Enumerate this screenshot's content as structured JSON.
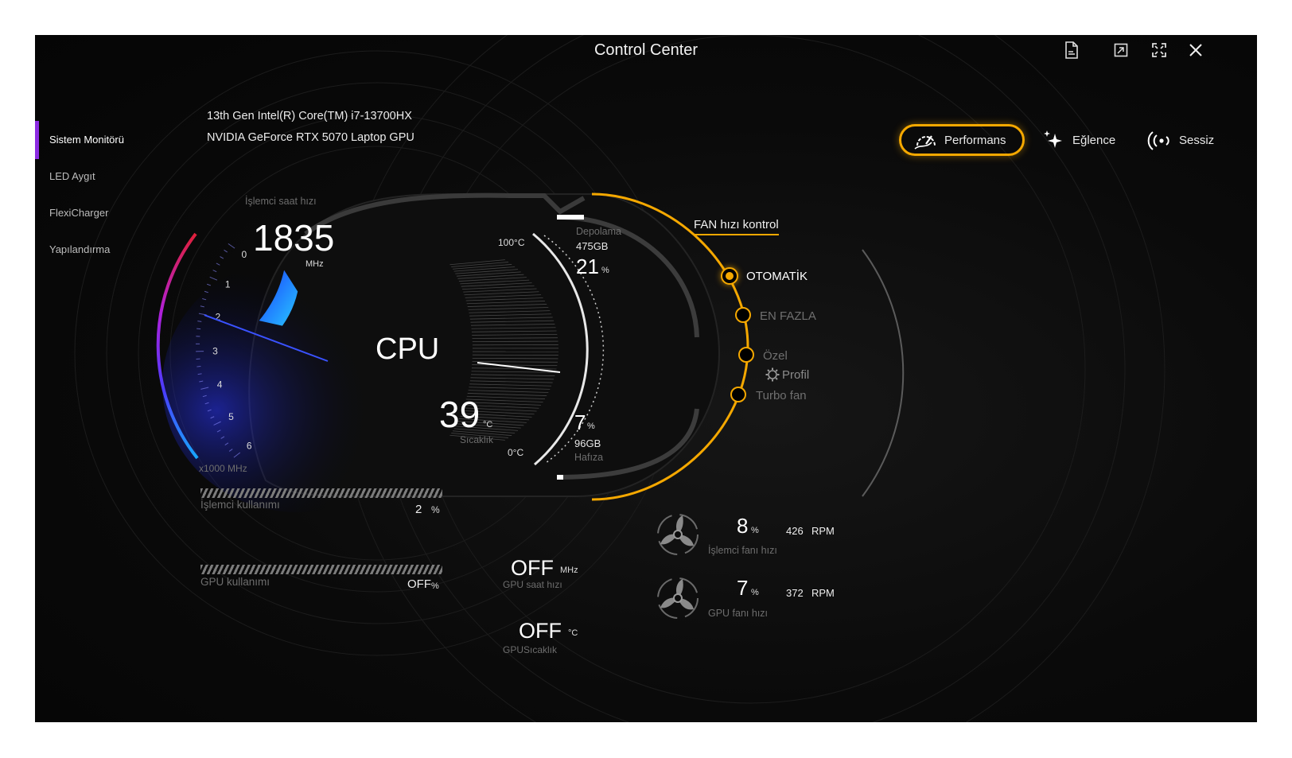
{
  "window": {
    "title": "Control Center"
  },
  "sidebar": {
    "items": [
      {
        "label": "Sistem Monitörü",
        "active": true
      },
      {
        "label": "LED Aygıt"
      },
      {
        "label": "FlexiCharger"
      },
      {
        "label": "Yapılandırma"
      }
    ]
  },
  "system": {
    "cpu_name": "13th Gen Intel(R) Core(TM) i7-13700HX",
    "gpu_name": "NVIDIA GeForce RTX 5070 Laptop GPU"
  },
  "modes": [
    {
      "label": "Performans",
      "icon": "speedometer-icon",
      "active": true
    },
    {
      "label": "Eğlence",
      "icon": "sparkle-icon"
    },
    {
      "label": "Sessiz",
      "icon": "quiet-wave-icon"
    }
  ],
  "cpu_clock": {
    "label": "İşlemci saat hızı",
    "value": "1835",
    "unit": "MHz",
    "scale_label": "x1000 MHz",
    "ticks": [
      "0",
      "1",
      "2",
      "3",
      "4",
      "5",
      "6"
    ],
    "level_ghz": 1.835
  },
  "cpu": {
    "title": "CPU",
    "temp_value": "39",
    "temp_unit": "°C",
    "temp_label": "Sıcaklık",
    "temp_max": "100°C",
    "temp_min": "0°C"
  },
  "storage": {
    "label": "Depolama",
    "size": "475GB",
    "value": "21",
    "unit": "%"
  },
  "memory": {
    "label": "Hafıza",
    "size": "96GB",
    "value": "7",
    "unit": "%"
  },
  "fan_control": {
    "title": "FAN hızı kontrol",
    "options": [
      {
        "label": "OTOMATİK",
        "selected": true
      },
      {
        "label": "EN FAZLA"
      },
      {
        "label": "Özel"
      },
      {
        "label": "Turbo fan"
      }
    ],
    "profile_label": "Profil"
  },
  "cpu_usage": {
    "label": "İşlemci kullanımı",
    "value": "2",
    "unit": "%"
  },
  "gpu_usage": {
    "label": "GPU kullanımı",
    "value": "OFF",
    "unit": "%"
  },
  "gpu_clock": {
    "label": "GPU saat hızı",
    "value": "OFF",
    "unit": "MHz"
  },
  "gpu_temp": {
    "label": "GPUSıcaklık",
    "value": "OFF",
    "unit": "°C"
  },
  "cpu_fan": {
    "label": "İşlemci fanı hızı",
    "value": "8",
    "unit": "%",
    "rpm": "426",
    "rpm_unit": "RPM"
  },
  "gpu_fan": {
    "label": "GPU fanı hızı",
    "value": "7",
    "unit": "%",
    "rpm": "372",
    "rpm_unit": "RPM"
  },
  "colors": {
    "accent": "#f5a800",
    "nav_active": "#8b2be2",
    "gauge_blue": "#1e6bff"
  }
}
